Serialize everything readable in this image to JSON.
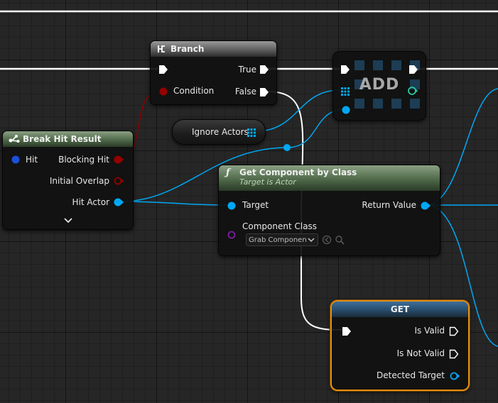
{
  "nodes": {
    "branch": {
      "title": "Branch",
      "pins": {
        "condition": "Condition",
        "true": "True",
        "false": "False"
      }
    },
    "add": {
      "title": "ADD"
    },
    "ignore_actors": {
      "label": "Ignore Actors"
    },
    "break_hit": {
      "title": "Break Hit Result",
      "pins": {
        "hit": "Hit",
        "blocking_hit": "Blocking Hit",
        "initial_overlap": "Initial Overlap",
        "hit_actor": "Hit Actor"
      }
    },
    "get_component": {
      "title": "Get Component by Class",
      "subtitle": "Target is Actor",
      "pins": {
        "target": "Target",
        "return_value": "Return Value",
        "component_class": "Component Class"
      },
      "component_class_value": "Grab Componen"
    },
    "get": {
      "title": "GET",
      "pins": {
        "is_valid": "Is Valid",
        "is_not_valid": "Is Not Valid",
        "detected_target": "Detected Target"
      }
    }
  },
  "colors": {
    "exec": "#ffffff",
    "object": "#00a8f4",
    "boolean": "#950000",
    "class": "#7a1ea1",
    "struct": "#1c4fd8",
    "selection": "#e48f12",
    "interface": "#2ac7a0"
  }
}
